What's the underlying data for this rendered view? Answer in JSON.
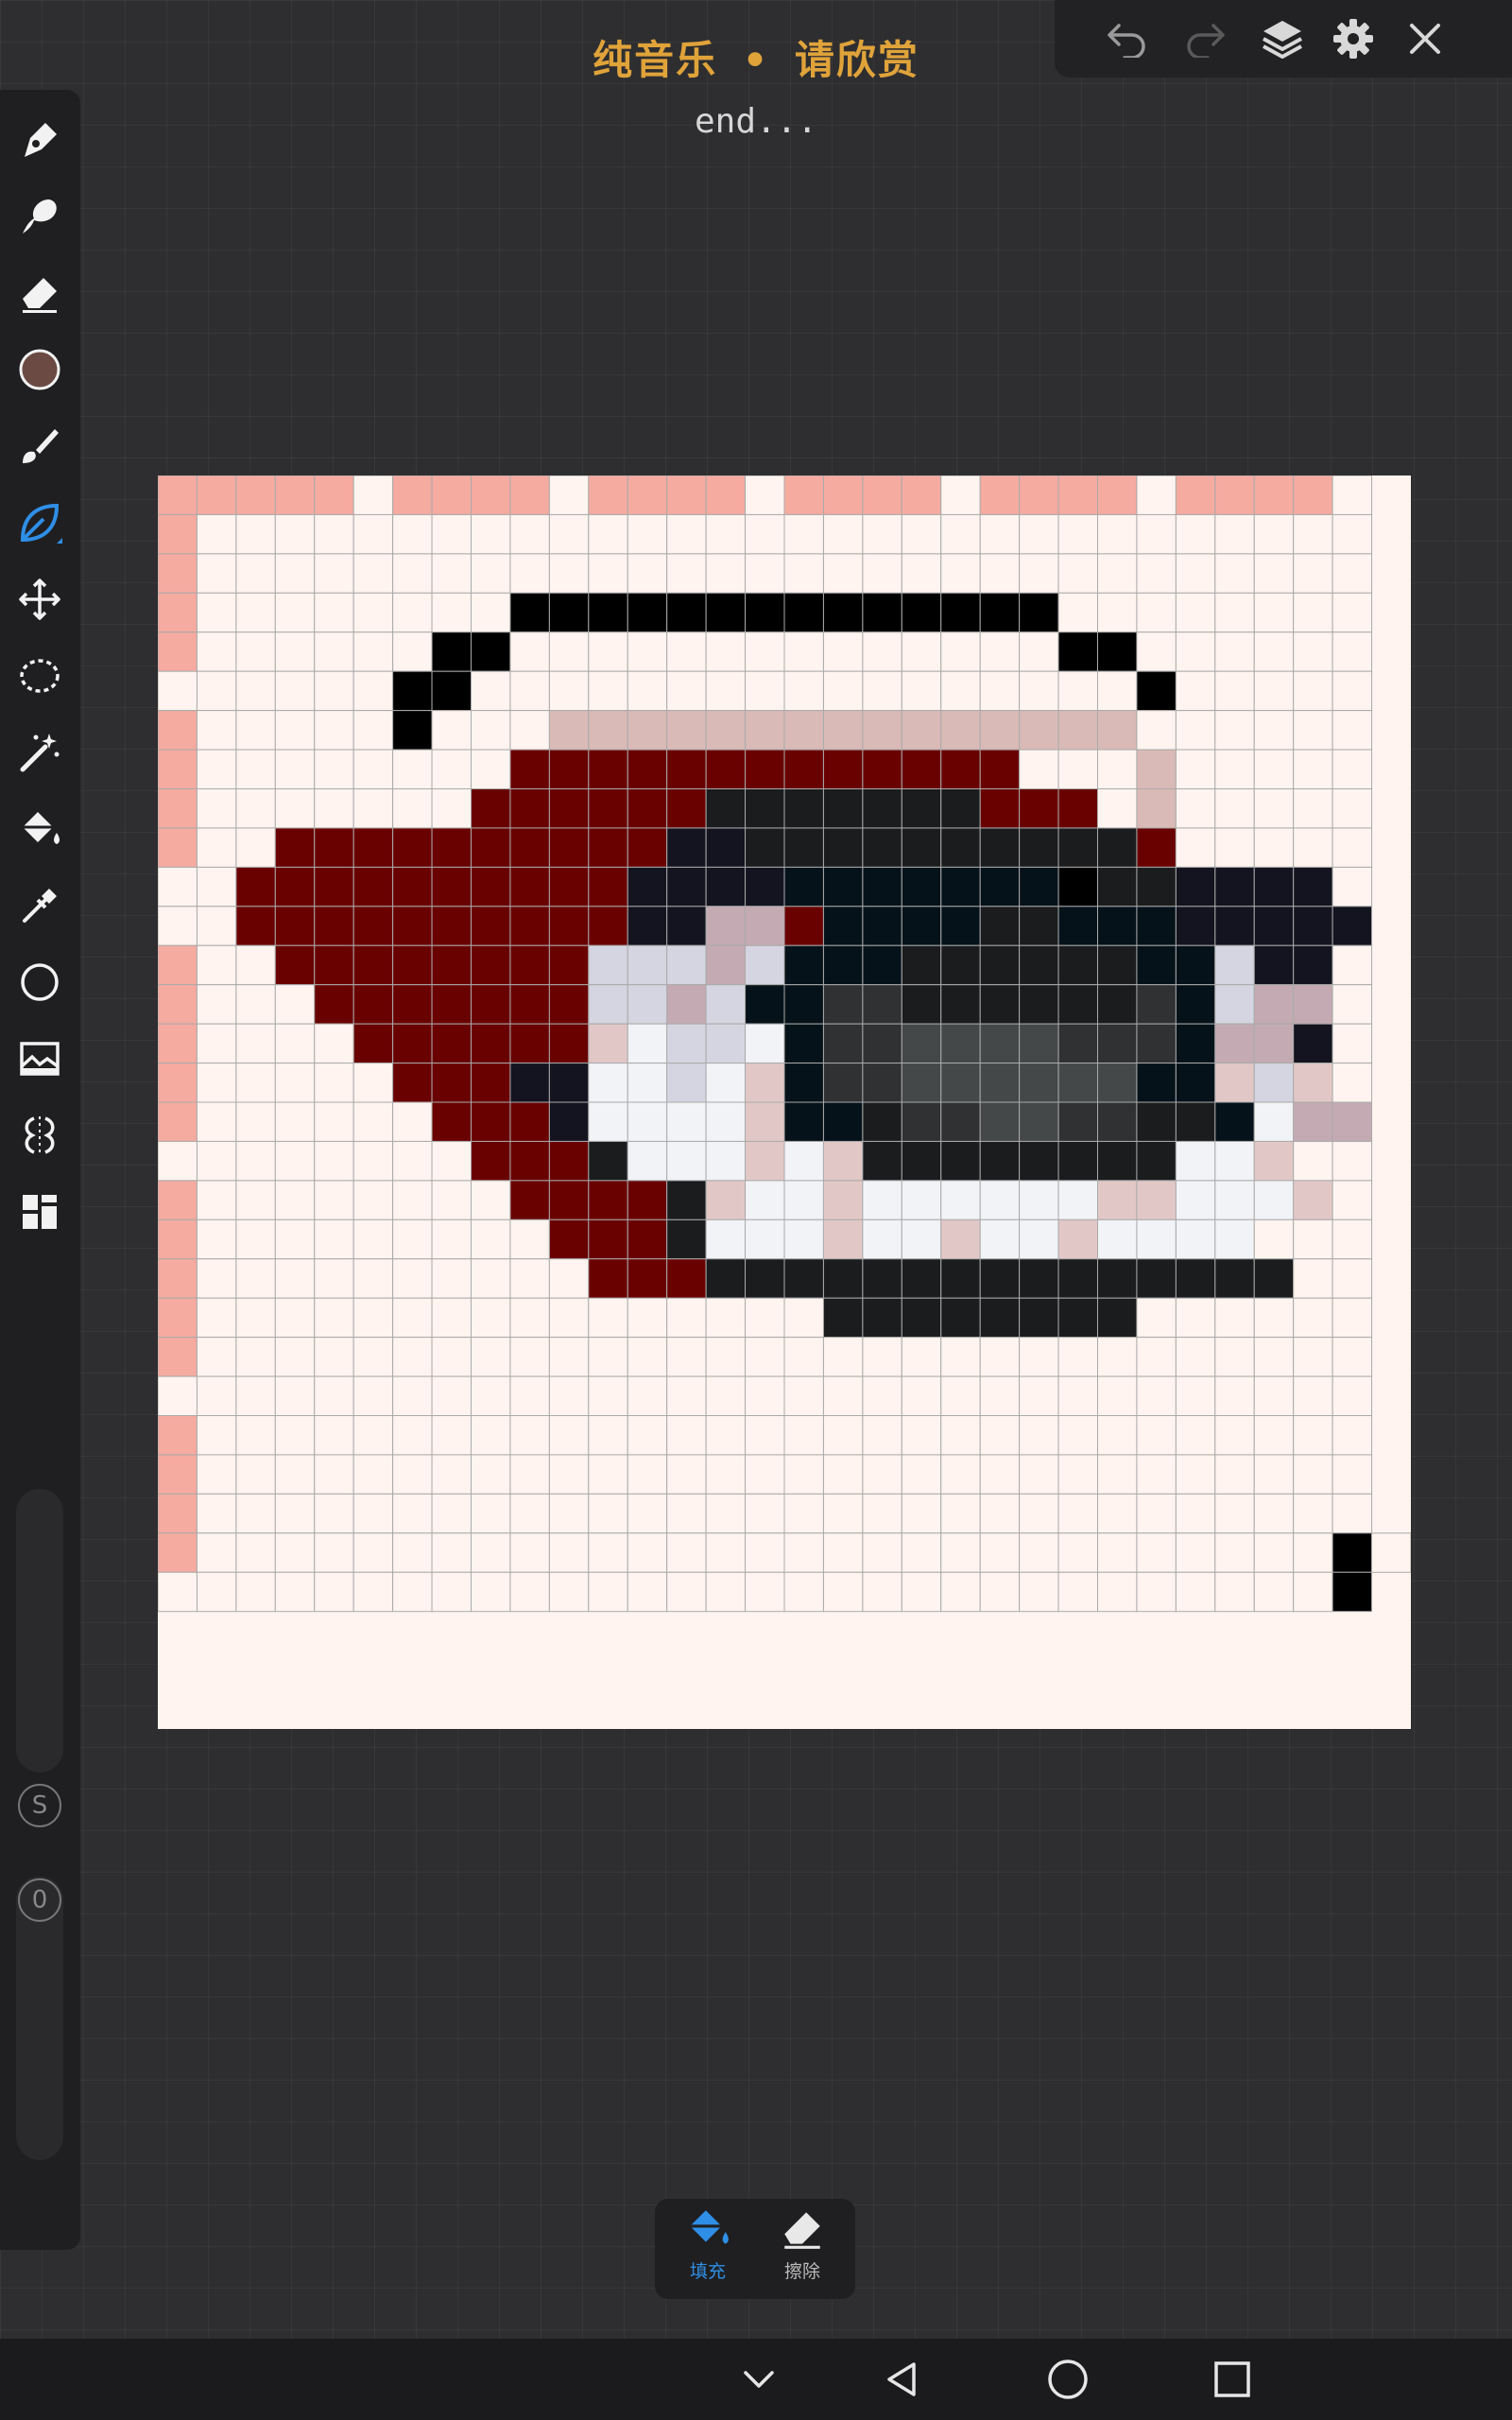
{
  "header": {
    "title": "纯音乐 • 请欣赏",
    "subtitle": "end..."
  },
  "top_actions": [
    {
      "name": "undo-icon"
    },
    {
      "name": "redo-icon"
    },
    {
      "name": "layers-icon"
    },
    {
      "name": "settings-icon"
    },
    {
      "name": "close-icon"
    }
  ],
  "tools": [
    {
      "name": "pen-tool-icon"
    },
    {
      "name": "smudge-tool-icon"
    },
    {
      "name": "eraser-tool-icon"
    },
    {
      "name": "color-swatch",
      "color": "#6b4a43"
    },
    {
      "name": "brush-tool-icon"
    },
    {
      "name": "leaf-brush-icon",
      "active": true
    },
    {
      "name": "move-tool-icon"
    },
    {
      "name": "lasso-tool-icon"
    },
    {
      "name": "magic-wand-icon"
    },
    {
      "name": "fill-bucket-icon"
    },
    {
      "name": "eyedropper-icon"
    },
    {
      "name": "shape-tool-icon"
    },
    {
      "name": "image-tool-icon"
    },
    {
      "name": "symmetry-tool-icon"
    },
    {
      "name": "more-tools-icon"
    }
  ],
  "sliders": {
    "size_label": "S",
    "opacity_label": "0"
  },
  "palette": {
    ".": "#fff4ef",
    "p": "#f5aba0",
    "k": "#000000",
    "t": "#d9bab6",
    "r": "#6a0101",
    "d": "#1b1c1e",
    "n": "#141420",
    "c": "#05121a",
    "m": "#2f3132",
    "g": "#454849",
    "l": "#d4d5e0",
    "s": "#c4aab2",
    "w": "#f1f3f7",
    "q": "#e1c8c6",
    "h": "#aaaaaa"
  },
  "pixel_rows": [
    "ppppp.pppp.pppp.pppp.pppp.pppp.",
    "p..............................",
    "p..............................",
    "p........kkkkkkkkkkkkkk........",
    "p......kk..............kk......",
    "......kk.................k.....",
    "p.....k...ttttttttttttttt......",
    "p........rrrrrrrrrrrrr...t.....",
    "p.......rrrrrrdddddddrrr.t.....",
    "p..rrrrrrrrrrnnddddddddddr.....",
    "..rrrrrrrrrrnnnnccccccckddnnnn.",
    "..rrrrrrrrrrnnssrccccddcccnnnnn",
    "p..rrrrrrrrlllslcccddddddcclnn.",
    "p...rrrrrrrllslccmmddddddmclss.",
    "p....rrrrrrqwllwcmmggggmmmcssn.",
    "p.....rrrnnwwlwqcmmggggggccqlq.",
    "p......rrrnwwwwqccdmmggmmddcwss",
    "........rrrdwwwqwqddddddddwwq..",
    "p........rrrrdqwwqwwwwwwqqwwwq.",
    "p.........rrrdwwwqwwqwwqwwww...",
    "p..........rrrddddddddddddddd..",
    "p................dddddddd......",
    "p..............................",
    "...............................",
    "p..............................",
    "p..............................",
    "p..............................",
    "p.............................k.",
    "..............................k"
  ],
  "bottom_tools": [
    {
      "name": "fill-button",
      "label": "填充",
      "active": true
    },
    {
      "name": "erase-button",
      "label": "擦除",
      "active": false
    }
  ],
  "navigation": [
    {
      "name": "nav-down-icon"
    },
    {
      "name": "nav-back-icon"
    },
    {
      "name": "nav-home-icon"
    },
    {
      "name": "nav-recents-icon"
    }
  ]
}
